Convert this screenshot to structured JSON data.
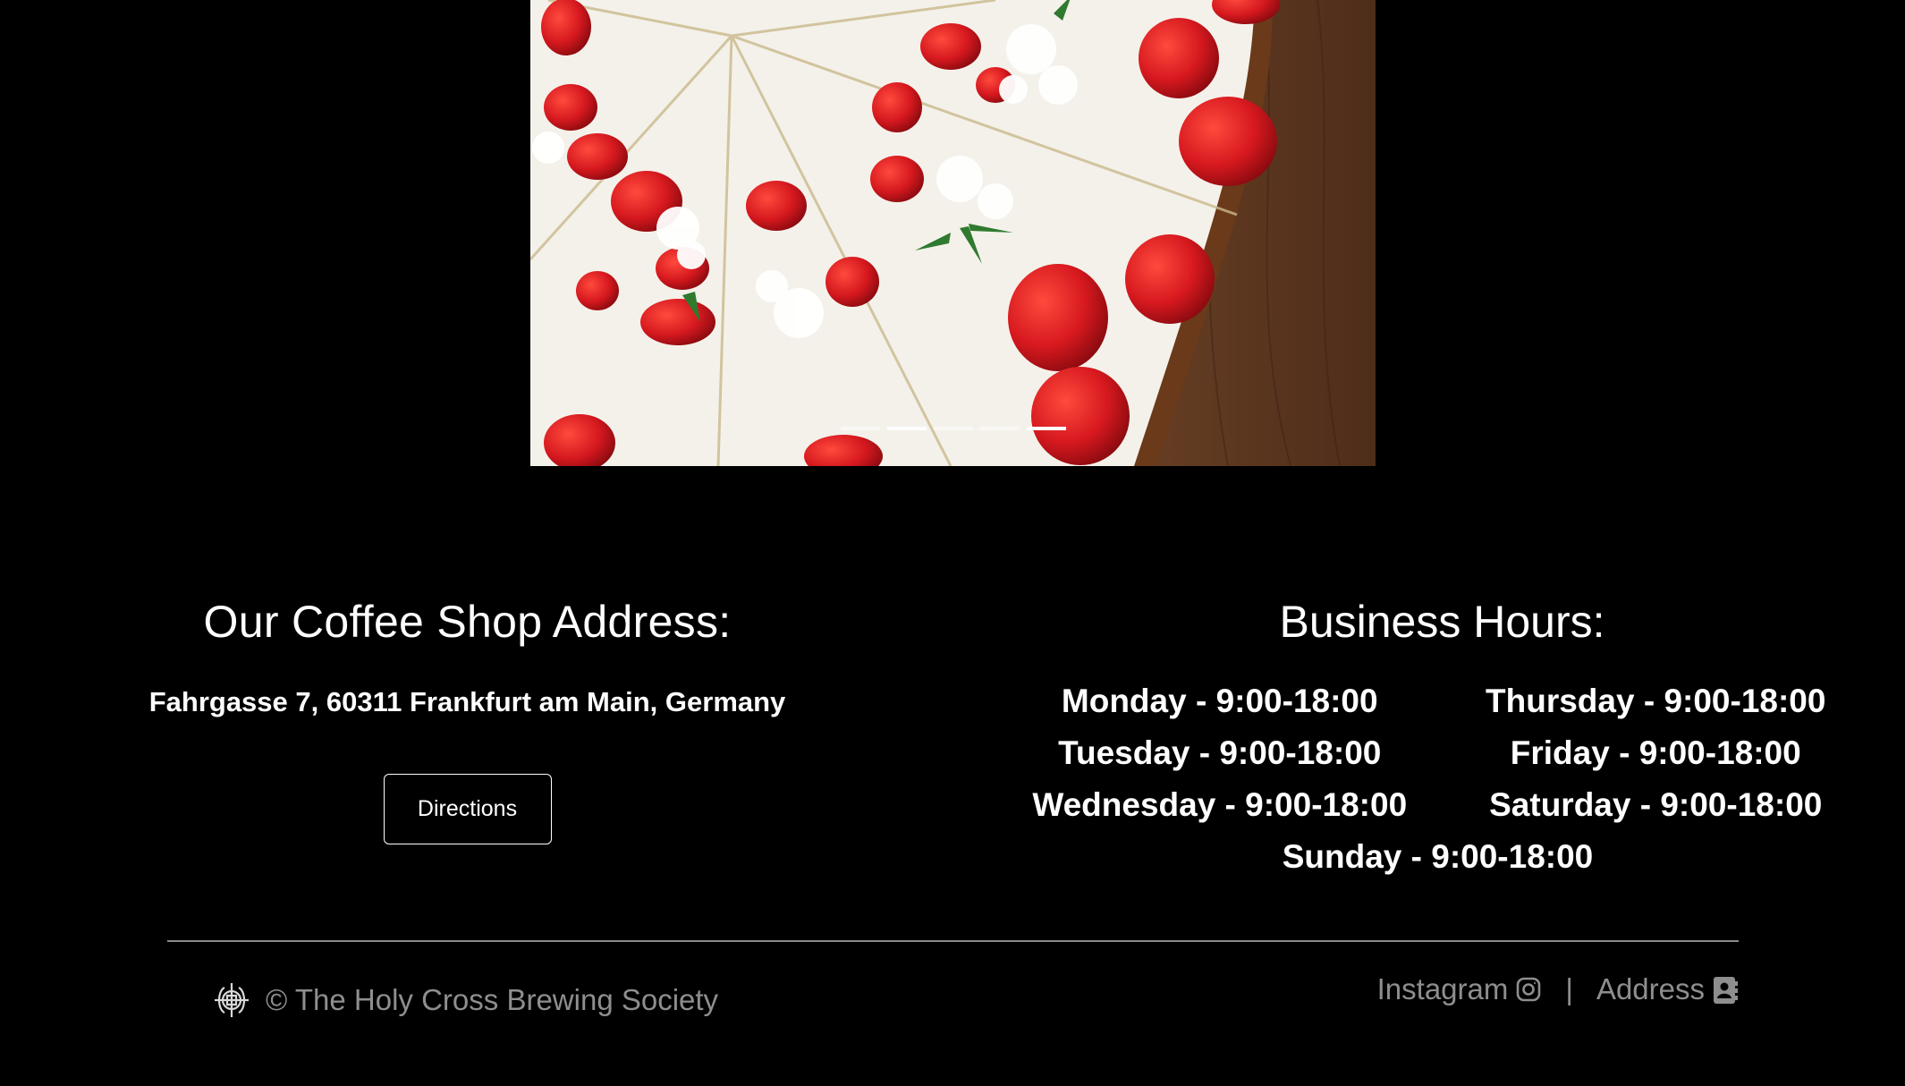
{
  "carousel": {
    "slide_count": 4,
    "active_index": 0
  },
  "address": {
    "title": "Our Coffee Shop Address:",
    "text": "Fahrgasse 7, 60311 Frankfurt am Main, Germany",
    "directions_label": "Directions"
  },
  "hours": {
    "title": "Business Hours:",
    "days": [
      "Monday - 9:00-18:00",
      "Thursday - 9:00-18:00",
      "Tuesday - 9:00-18:00",
      "Friday - 9:00-18:00",
      "Wednesday - 9:00-18:00",
      "Saturday - 9:00-18:00",
      "Sunday - 9:00-18:00"
    ]
  },
  "footer": {
    "copyright": "© The Holy Cross Brewing Society",
    "instagram_label": "Instagram",
    "separator": "|",
    "address_label": "Address",
    "icons": {
      "logo": "holy-cross-logo",
      "instagram": "instagram-icon",
      "address": "address-book-icon"
    }
  },
  "colors": {
    "background": "#000000",
    "text": "#ffffff",
    "muted": "#8e8e8e",
    "strawberry": "#d7191f",
    "wood": "#6b4026"
  }
}
